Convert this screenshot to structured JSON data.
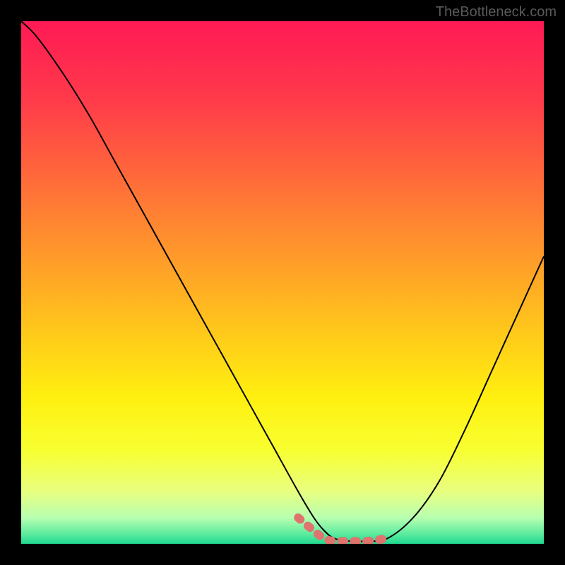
{
  "watermark": "TheBottleneck.com",
  "chart_data": {
    "type": "line",
    "title": "",
    "xlabel": "",
    "ylabel": "",
    "xlim": [
      0,
      100
    ],
    "ylim": [
      0,
      100
    ],
    "series": [
      {
        "name": "curve",
        "color": "#000000",
        "x": [
          0,
          3,
          8,
          13,
          18,
          23,
          28,
          33,
          38,
          43,
          48,
          53,
          56,
          58,
          60,
          63,
          66,
          70,
          75,
          80,
          85,
          90,
          95,
          100
        ],
        "y": [
          100,
          97,
          90,
          82,
          73,
          64,
          55,
          46,
          37,
          28,
          19,
          10,
          5,
          2.5,
          1,
          0.5,
          0.5,
          1,
          5,
          12,
          22,
          33,
          44,
          55
        ]
      },
      {
        "name": "optimal-range",
        "color": "#e0736d",
        "thick": true,
        "x": [
          53,
          56,
          58,
          60,
          63,
          66,
          70
        ],
        "y": [
          5,
          2.5,
          1,
          0.5,
          0.5,
          0.5,
          1
        ]
      }
    ],
    "gradient_bands": [
      {
        "y": 100,
        "color": "#ff1a55"
      },
      {
        "y": 85,
        "color": "#ff3a4a"
      },
      {
        "y": 70,
        "color": "#ff6a3a"
      },
      {
        "y": 55,
        "color": "#ff9a2a"
      },
      {
        "y": 40,
        "color": "#ffca1a"
      },
      {
        "y": 28,
        "color": "#fff010"
      },
      {
        "y": 18,
        "color": "#f8ff30"
      },
      {
        "y": 10,
        "color": "#e8ff80"
      },
      {
        "y": 5,
        "color": "#b8ffb0"
      },
      {
        "y": 2,
        "color": "#60eca0"
      },
      {
        "y": 0,
        "color": "#20d890"
      }
    ]
  }
}
